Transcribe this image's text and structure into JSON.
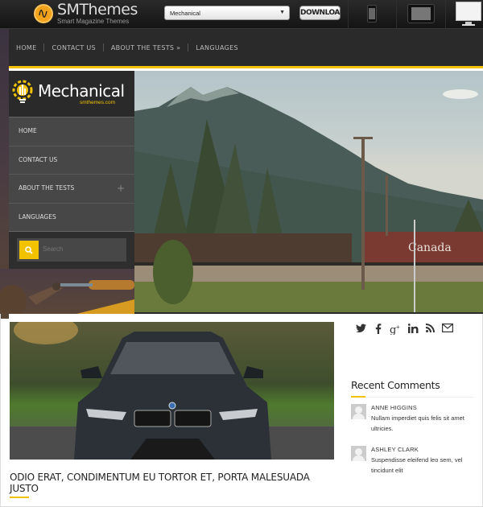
{
  "topbar": {
    "brand_name": "SMThemes",
    "brand_tagline": "Smart Magazine Themes",
    "theme_select_value": "Mechanical",
    "download_label": "DOWNLOAD",
    "devices": [
      "phone",
      "tablet",
      "desktop"
    ]
  },
  "nav": {
    "items": [
      {
        "label": "HOME"
      },
      {
        "label": "CONTACT US"
      },
      {
        "label": "ABOUT THE TESTS »"
      },
      {
        "label": "LANGUAGES"
      }
    ]
  },
  "sidebar": {
    "logo_title": "Mechanical",
    "logo_sub": "smthemes.com",
    "menu": [
      {
        "label": "HOME"
      },
      {
        "label": "CONTACT US"
      },
      {
        "label": "ABOUT THE TESTS",
        "expand_icon": "plus-icon"
      },
      {
        "label": "LANGUAGES"
      }
    ],
    "search_placeholder": "Search"
  },
  "post": {
    "title": "ODIO ERAT, CONDIMENTUM EU TORTOR ET, PORTA MALESUADA JUSTO"
  },
  "social": [
    "twitter-icon",
    "facebook-icon",
    "google-plus-icon",
    "linkedin-icon",
    "rss-icon",
    "email-icon"
  ],
  "recent_comments": {
    "title": "Recent Comments",
    "items": [
      {
        "author": "ANNE HIGGINS",
        "text": "Nullam imperdiet quis felis sit amet ultricies."
      },
      {
        "author": "ASHLEY CLARK",
        "text": "Suspendisse eleifend leo sem, vel tincidunt elit"
      }
    ]
  },
  "colors": {
    "accent": "#f2c200",
    "nav_bg": "#2a2a2a",
    "menu_bg": "#474747"
  }
}
